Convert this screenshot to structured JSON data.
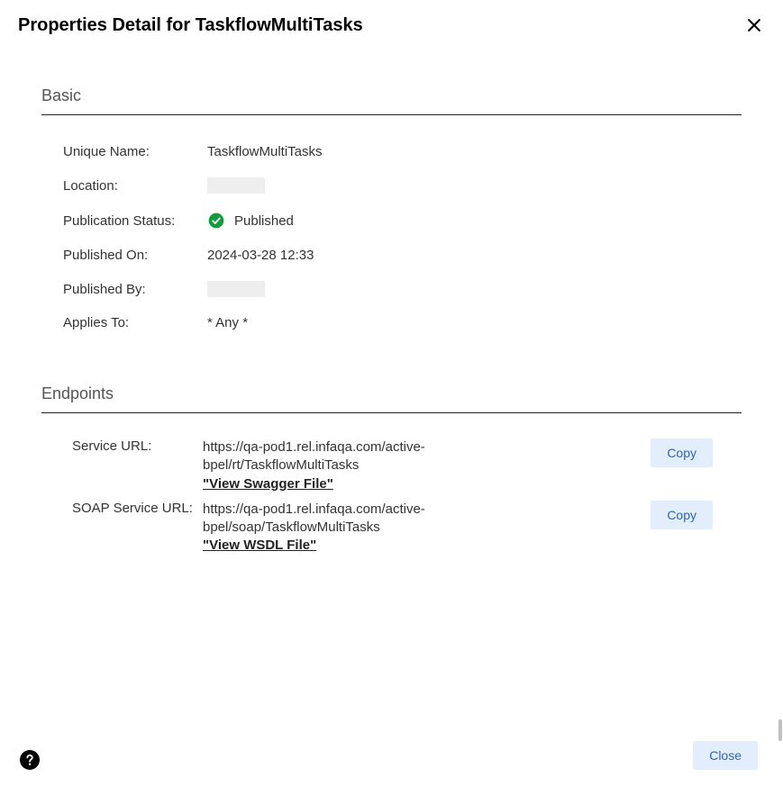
{
  "dialog": {
    "title": "Properties Detail for TaskflowMultiTasks"
  },
  "basic": {
    "section_title": "Basic",
    "fields": {
      "unique_name": {
        "label": "Unique Name:",
        "value": "TaskflowMultiTasks"
      },
      "location": {
        "label": "Location:",
        "value": ""
      },
      "publication_status": {
        "label": "Publication Status:",
        "value": "Published"
      },
      "published_on": {
        "label": "Published On:",
        "value": "2024-03-28 12:33"
      },
      "published_by": {
        "label": "Published By:",
        "value": ""
      },
      "applies_to": {
        "label": "Applies To:",
        "value": "* Any *"
      }
    }
  },
  "endpoints": {
    "section_title": "Endpoints",
    "service_url": {
      "label": "Service URL:",
      "value": "https://qa-pod1.rel.infaqa.com/active-bpel/rt/TaskflowMultiTasks",
      "link_text": "\"View Swagger File\"",
      "copy_label": "Copy"
    },
    "soap_service_url": {
      "label": "SOAP Service URL:",
      "value": "https://qa-pod1.rel.infaqa.com/active-bpel/soap/TaskflowMultiTasks",
      "link_text": "\"View WSDL File\"",
      "copy_label": "Copy"
    }
  },
  "footer": {
    "close_label": "Close"
  }
}
